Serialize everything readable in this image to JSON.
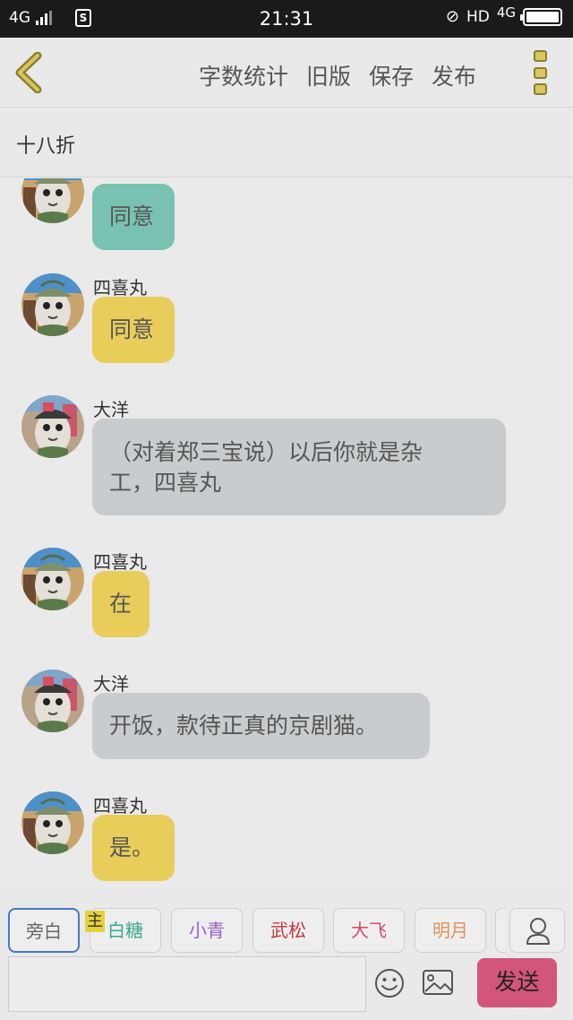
{
  "status_bar": {
    "network_left": "4G",
    "sim_icon": "S",
    "time": "21:31",
    "hd": "HD",
    "network_right": "4G"
  },
  "toolbar": {
    "actions": [
      "字数统计",
      "旧版",
      "保存",
      "发布"
    ]
  },
  "title": "十八折",
  "messages": [
    {
      "sender": "",
      "text_lines": [
        "同意"
      ],
      "color": "teal"
    },
    {
      "sender": "四喜丸",
      "text_lines": [
        "同意"
      ],
      "color": "yellow"
    },
    {
      "sender": "大洋",
      "text_lines": [
        "（对着郑三宝说）以后你就是杂",
        "工，四喜丸"
      ],
      "color": "gray"
    },
    {
      "sender": "四喜丸",
      "text_lines": [
        "在"
      ],
      "color": "yellow"
    },
    {
      "sender": "大洋",
      "text_lines": [
        "开饭，款待正真的京剧猫。"
      ],
      "color": "gray"
    },
    {
      "sender": "四喜丸",
      "text_lines": [
        "是。"
      ],
      "color": "yellow"
    }
  ],
  "roles": [
    {
      "label": "旁白",
      "color": "#666666",
      "active": true
    },
    {
      "label": "白糖",
      "color": "#3aa88e"
    },
    {
      "label": "小青",
      "color": "#9560c4"
    },
    {
      "label": "武松",
      "color": "#c23a3a"
    },
    {
      "label": "大飞",
      "color": "#d04a6a"
    },
    {
      "label": "明月",
      "color": "#e0925a"
    }
  ],
  "host_tag": "主",
  "composer": {
    "input_value": "",
    "send_label": "发送"
  },
  "colors": {
    "bubble_teal": "#79c2b2",
    "bubble_yellow": "#e8cd5b",
    "bubble_gray": "#c9ccce",
    "send_button": "#d2567a",
    "active_role_border": "#4a78c6"
  },
  "icons": [
    "back-arrow-icon",
    "more-menu-icon",
    "emoji-icon",
    "image-icon",
    "user-icon"
  ]
}
